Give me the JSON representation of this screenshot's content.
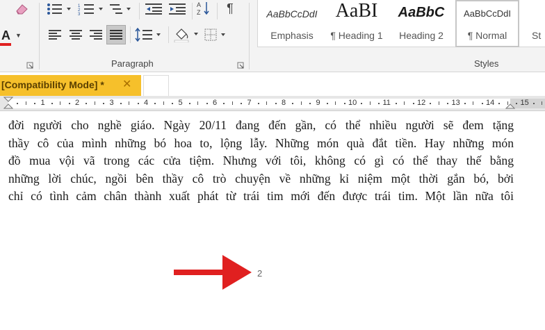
{
  "ribbon": {
    "paragraph_group_label": "Paragraph",
    "styles_group_label": "Styles",
    "styles": [
      {
        "sample": "AaBbCcDdI",
        "name": "Emphasis"
      },
      {
        "sample": "AaBI",
        "name": "¶ Heading 1"
      },
      {
        "sample": "AaBbC",
        "name": "Heading 2"
      },
      {
        "sample": "AaBbCcDdI",
        "name": "¶ Normal"
      },
      {
        "sample": "",
        "name": "St"
      }
    ],
    "font_color_glyph": "A",
    "font_color_hex": "#e02020"
  },
  "tabs": {
    "doc_title": "[Compatibility Mode] *",
    "close_glyph": "✕"
  },
  "ruler": {
    "numbers": [
      "1",
      "2",
      "3",
      "4",
      "5",
      "6",
      "7",
      "8",
      "9",
      "10",
      "11",
      "12",
      "13",
      "14",
      "15"
    ]
  },
  "document": {
    "lines": [
      "đời người cho nghề giáo. Ngày 20/11 đang đến gần, có thể nhiều người sẽ đem tặng",
      "thầy cô của mình những bó hoa to, lộng lẫy. Những món quà đắt tiền. Hay những món",
      "đồ mua vội vã trong các cửa tiệm. Nhưng với tôi, không có gì có thể thay thế bằng",
      "những lời chúc, ngồi bên thầy cô trò chuyện về những kỉ niệm một thời gắn bó, bởi",
      "chỉ có tình cảm chân thành xuất phát từ trái tim mới đến được trái tim. Một lần nữa tôi"
    ],
    "page_number": "2",
    "arrow_color": "#e02020"
  }
}
